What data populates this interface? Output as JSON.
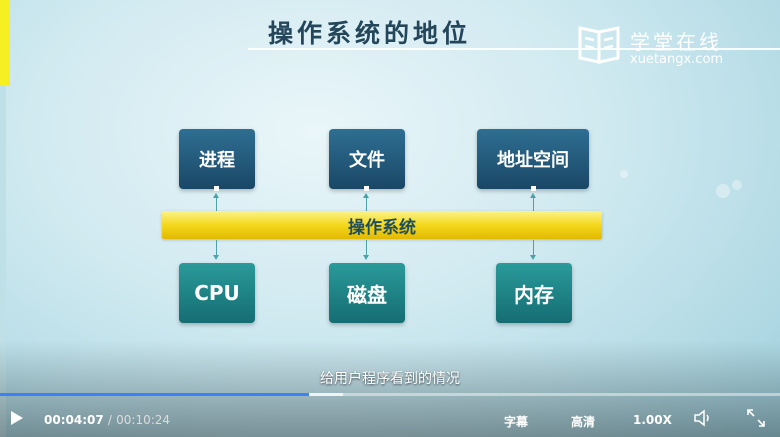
{
  "slide": {
    "title": "操作系统的地位",
    "logo": {
      "name_cn": "学堂在线",
      "domain": "xuetangx.com"
    },
    "top_boxes": [
      "进程",
      "文件",
      "地址空间"
    ],
    "middle_bar": "操作系统",
    "bottom_boxes": [
      "CPU",
      "磁盘",
      "内存"
    ]
  },
  "subtitle": "给用户程序看到的情况",
  "player": {
    "current_time": "00:04:07",
    "separator": "/",
    "total_time": "00:10:24",
    "subtitles_label": "字幕",
    "quality_label": "高清",
    "speed_label": "1.00X",
    "progress_fraction": 0.396,
    "buffered_fraction": 0.44,
    "icons": {
      "play": "play-icon",
      "volume": "volume-icon",
      "fullscreen": "fullscreen-icon"
    },
    "colors": {
      "progress": "#3b82f6",
      "accent_yellow": "#f6ef22"
    }
  }
}
